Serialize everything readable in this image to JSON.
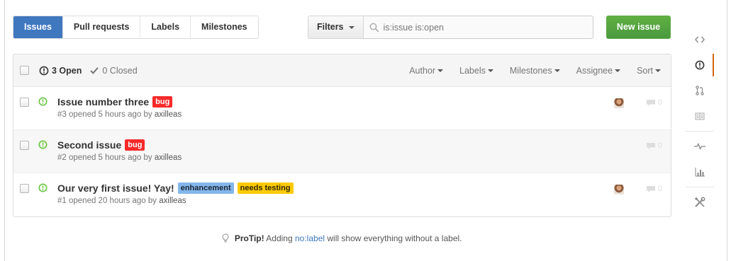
{
  "subnav": {
    "items": [
      {
        "label": "Issues",
        "selected": true
      },
      {
        "label": "Pull requests"
      },
      {
        "label": "Labels"
      },
      {
        "label": "Milestones"
      }
    ]
  },
  "filters": {
    "button_label": "Filters",
    "search_value": "is:issue is:open"
  },
  "new_issue_label": "New issue",
  "header": {
    "open_label": "3 Open",
    "closed_label": "0 Closed",
    "filters": [
      "Author",
      "Labels",
      "Milestones",
      "Assignee",
      "Sort"
    ]
  },
  "issues": [
    {
      "title": "Issue number three",
      "labels": [
        {
          "name": "bug",
          "color": "#fc2929"
        }
      ],
      "meta_prefix": "#3 opened 5 hours ago by",
      "author": "axilleas",
      "has_avatar": true,
      "comments": "0"
    },
    {
      "title": "Second issue",
      "labels": [
        {
          "name": "bug",
          "color": "#fc2929"
        }
      ],
      "meta_prefix": "#2 opened 5 hours ago by",
      "author": "axilleas",
      "has_avatar": false,
      "comments": "0"
    },
    {
      "title": "Our very first issue! Yay!",
      "labels": [
        {
          "name": "enhancement",
          "color": "#84b6eb"
        },
        {
          "name": "needs testing",
          "color": "#fbca04"
        }
      ],
      "meta_prefix": "#1 opened 20 hours ago by",
      "author": "axilleas",
      "has_avatar": true,
      "comments": "0"
    }
  ],
  "protip": {
    "strong": "ProTip!",
    "before": "Adding",
    "link": "no:label",
    "after": "will show everything without a label."
  },
  "sidebar_icons": [
    "code-icon",
    "issue-opened-icon",
    "git-pull-request-icon",
    "book-icon",
    "pulse-icon",
    "graph-icon",
    "tools-icon"
  ],
  "colors": {
    "accent": "#4078c0",
    "green": "#55a532",
    "new_issue": "#60b044",
    "active_indicator": "#d26911"
  }
}
